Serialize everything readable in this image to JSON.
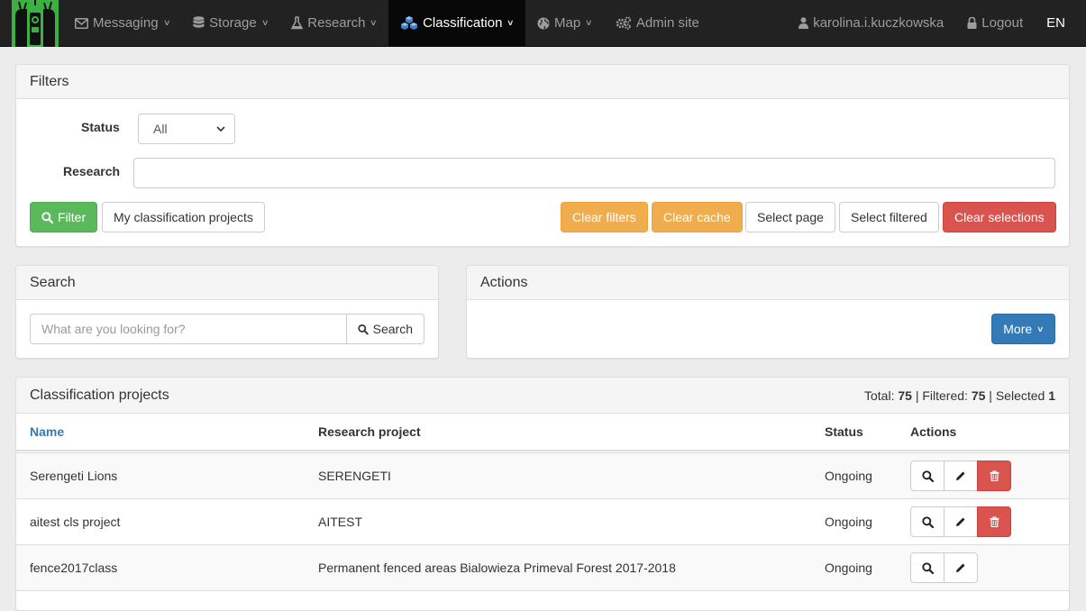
{
  "nav": {
    "items": [
      {
        "label": "Messaging",
        "icon": "envelope-icon",
        "active": false
      },
      {
        "label": "Storage",
        "icon": "database-icon",
        "active": false
      },
      {
        "label": "Research",
        "icon": "flask-icon",
        "active": false
      },
      {
        "label": "Classification",
        "icon": "cubes-icon",
        "active": true
      },
      {
        "label": "Map",
        "icon": "globe-icon",
        "active": false
      },
      {
        "label": "Admin site",
        "icon": "gears-icon",
        "active": false
      }
    ],
    "user": "karolina.i.kuczkowska",
    "logout": "Logout",
    "language": "EN"
  },
  "filters": {
    "title": "Filters",
    "status_label": "Status",
    "status_value": "All",
    "research_label": "Research",
    "research_value": "",
    "filter_button": "Filter",
    "my_projects_button": "My classification projects",
    "clear_filters": "Clear filters",
    "clear_cache": "Clear cache",
    "select_page": "Select page",
    "select_filtered": "Select filtered",
    "clear_selections": "Clear selections"
  },
  "search": {
    "title": "Search",
    "placeholder": "What are you looking for?",
    "button": "Search"
  },
  "actions": {
    "title": "Actions",
    "more_button": "More"
  },
  "projects": {
    "title": "Classification projects",
    "total_label": "Total:",
    "total": "75",
    "filtered_label": "Filtered:",
    "filtered": "75",
    "selected_label": "Selected",
    "selected": "1",
    "columns": {
      "name": "Name",
      "research": "Research project",
      "status": "Status",
      "actions": "Actions"
    },
    "rows": [
      {
        "name": "Serengeti Lions",
        "research": "SERENGETI",
        "status": "Ongoing",
        "deletable": true
      },
      {
        "name": "aitest cls project",
        "research": "AITEST",
        "status": "Ongoing",
        "deletable": true
      },
      {
        "name": "fence2017class",
        "research": "Permanent fenced areas Bialowieza Primeval Forest 2017-2018",
        "status": "Ongoing",
        "deletable": false
      }
    ]
  },
  "colors": {
    "navbar": "#222222",
    "success": "#5cb85c",
    "warning": "#f0ad4e",
    "danger": "#d9534f",
    "primary": "#337ab7",
    "logo": "#3cb043"
  }
}
